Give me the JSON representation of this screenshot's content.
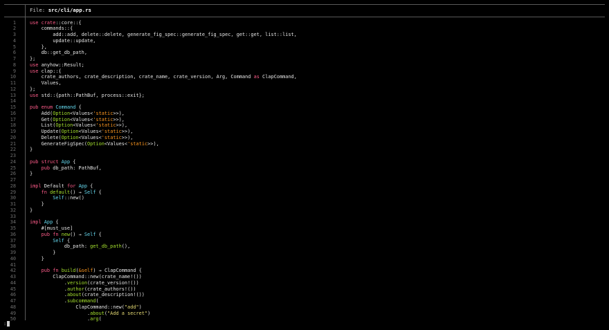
{
  "header": {
    "label": "File: ",
    "path": "src/cli/app.rs"
  },
  "prompt": ":",
  "lines": [
    {
      "n": "1",
      "t": [
        [
          "kw",
          "use"
        ],
        [
          "pt",
          " "
        ],
        [
          "kw",
          "crate"
        ],
        [
          "pt",
          "::core::{"
        ]
      ]
    },
    {
      "n": "2",
      "t": [
        [
          "pt",
          "    commands::{"
        ]
      ]
    },
    {
      "n": "3",
      "t": [
        [
          "pt",
          "        add::add, delete::delete, generate_fig_spec::generate_fig_spec, get::get, list::list,"
        ]
      ]
    },
    {
      "n": "4",
      "t": [
        [
          "pt",
          "        update::update,"
        ]
      ]
    },
    {
      "n": "5",
      "t": [
        [
          "pt",
          "    },"
        ]
      ]
    },
    {
      "n": "6",
      "t": [
        [
          "pt",
          "    db::get_db_path,"
        ]
      ]
    },
    {
      "n": "7",
      "t": [
        [
          "pt",
          "};"
        ]
      ]
    },
    {
      "n": "8",
      "t": [
        [
          "kw",
          "use"
        ],
        [
          "pt",
          " anyhow::Result;"
        ]
      ]
    },
    {
      "n": "9",
      "t": [
        [
          "kw",
          "use"
        ],
        [
          "pt",
          " clap::{"
        ]
      ]
    },
    {
      "n": "10",
      "t": [
        [
          "pt",
          "    crate_authors, crate_description, crate_name, crate_version, Arg, Command "
        ],
        [
          "kw",
          "as"
        ],
        [
          "pt",
          " ClapCommand,"
        ]
      ]
    },
    {
      "n": "11",
      "t": [
        [
          "pt",
          "    Values,"
        ]
      ]
    },
    {
      "n": "12",
      "t": [
        [
          "pt",
          "};"
        ]
      ]
    },
    {
      "n": "13",
      "t": [
        [
          "kw",
          "use"
        ],
        [
          "pt",
          " std::{path::PathBuf, process::exit};"
        ]
      ]
    },
    {
      "n": "14",
      "t": [
        [
          "pt",
          ""
        ]
      ]
    },
    {
      "n": "15",
      "t": [
        [
          "kw",
          "pub"
        ],
        [
          "pt",
          " "
        ],
        [
          "kw",
          "enum"
        ],
        [
          "pt",
          " "
        ],
        [
          "ty",
          "Command"
        ],
        [
          "pt",
          " {"
        ]
      ]
    },
    {
      "n": "16",
      "t": [
        [
          "pt",
          "    Add("
        ],
        [
          "gn",
          "Option"
        ],
        [
          "pt",
          "<Values<"
        ],
        [
          "lt",
          "'static"
        ],
        [
          "pt",
          ">>),"
        ]
      ]
    },
    {
      "n": "17",
      "t": [
        [
          "pt",
          "    Get("
        ],
        [
          "gn",
          "Option"
        ],
        [
          "pt",
          "<Values<"
        ],
        [
          "lt",
          "'static"
        ],
        [
          "pt",
          ">>),"
        ]
      ]
    },
    {
      "n": "18",
      "t": [
        [
          "pt",
          "    List("
        ],
        [
          "gn",
          "Option"
        ],
        [
          "pt",
          "<Values<"
        ],
        [
          "lt",
          "'static"
        ],
        [
          "pt",
          ">>),"
        ]
      ]
    },
    {
      "n": "19",
      "t": [
        [
          "pt",
          "    Update("
        ],
        [
          "gn",
          "Option"
        ],
        [
          "pt",
          "<Values<"
        ],
        [
          "lt",
          "'static"
        ],
        [
          "pt",
          ">>),"
        ]
      ]
    },
    {
      "n": "20",
      "t": [
        [
          "pt",
          "    Delete("
        ],
        [
          "gn",
          "Option"
        ],
        [
          "pt",
          "<Values<"
        ],
        [
          "lt",
          "'static"
        ],
        [
          "pt",
          ">>),"
        ]
      ]
    },
    {
      "n": "21",
      "t": [
        [
          "pt",
          "    GenerateFigSpec("
        ],
        [
          "gn",
          "Option"
        ],
        [
          "pt",
          "<Values<"
        ],
        [
          "lt",
          "'static"
        ],
        [
          "pt",
          ">>),"
        ]
      ]
    },
    {
      "n": "22",
      "t": [
        [
          "pt",
          "}"
        ]
      ]
    },
    {
      "n": "23",
      "t": [
        [
          "pt",
          ""
        ]
      ]
    },
    {
      "n": "24",
      "t": [
        [
          "kw",
          "pub"
        ],
        [
          "pt",
          " "
        ],
        [
          "kw",
          "struct"
        ],
        [
          "pt",
          " "
        ],
        [
          "ty",
          "App"
        ],
        [
          "pt",
          " {"
        ]
      ]
    },
    {
      "n": "25",
      "t": [
        [
          "pt",
          "    "
        ],
        [
          "kw",
          "pub"
        ],
        [
          "pt",
          " db_path: PathBuf,"
        ]
      ]
    },
    {
      "n": "26",
      "t": [
        [
          "pt",
          "}"
        ]
      ]
    },
    {
      "n": "27",
      "t": [
        [
          "pt",
          ""
        ]
      ]
    },
    {
      "n": "28",
      "t": [
        [
          "kw",
          "impl"
        ],
        [
          "pt",
          " Default "
        ],
        [
          "kw",
          "for"
        ],
        [
          "pt",
          " "
        ],
        [
          "ty",
          "App"
        ],
        [
          "pt",
          " {"
        ]
      ]
    },
    {
      "n": "29",
      "t": [
        [
          "pt",
          "    "
        ],
        [
          "kw",
          "fn"
        ],
        [
          "pt",
          " "
        ],
        [
          "fn",
          "default"
        ],
        [
          "pt",
          "() → "
        ],
        [
          "ty",
          "Self"
        ],
        [
          "pt",
          " {"
        ]
      ]
    },
    {
      "n": "30",
      "t": [
        [
          "pt",
          "        "
        ],
        [
          "ty",
          "Self"
        ],
        [
          "pt",
          "::new()"
        ]
      ]
    },
    {
      "n": "31",
      "t": [
        [
          "pt",
          "    }"
        ]
      ]
    },
    {
      "n": "32",
      "t": [
        [
          "pt",
          "}"
        ]
      ]
    },
    {
      "n": "33",
      "t": [
        [
          "pt",
          ""
        ]
      ]
    },
    {
      "n": "34",
      "t": [
        [
          "kw",
          "impl"
        ],
        [
          "pt",
          " "
        ],
        [
          "ty",
          "App"
        ],
        [
          "pt",
          " {"
        ]
      ]
    },
    {
      "n": "35",
      "t": [
        [
          "pt",
          "    #[must_use]"
        ]
      ]
    },
    {
      "n": "36",
      "t": [
        [
          "pt",
          "    "
        ],
        [
          "kw",
          "pub"
        ],
        [
          "pt",
          " "
        ],
        [
          "kw",
          "fn"
        ],
        [
          "pt",
          " "
        ],
        [
          "fn",
          "new"
        ],
        [
          "pt",
          "() → "
        ],
        [
          "ty",
          "Self"
        ],
        [
          "pt",
          " {"
        ]
      ]
    },
    {
      "n": "37",
      "t": [
        [
          "pt",
          "        "
        ],
        [
          "ty",
          "Self"
        ],
        [
          "pt",
          " {"
        ]
      ]
    },
    {
      "n": "38",
      "t": [
        [
          "pt",
          "            db_path: "
        ],
        [
          "fn",
          "get_db_path"
        ],
        [
          "pt",
          "(),"
        ]
      ]
    },
    {
      "n": "39",
      "t": [
        [
          "pt",
          "        }"
        ]
      ]
    },
    {
      "n": "40",
      "t": [
        [
          "pt",
          "    }"
        ]
      ]
    },
    {
      "n": "41",
      "t": [
        [
          "pt",
          ""
        ]
      ]
    },
    {
      "n": "42",
      "t": [
        [
          "pt",
          "    "
        ],
        [
          "kw",
          "pub"
        ],
        [
          "pt",
          " "
        ],
        [
          "kw",
          "fn"
        ],
        [
          "pt",
          " "
        ],
        [
          "fn",
          "build"
        ],
        [
          "pt",
          "("
        ],
        [
          "lt",
          "&self"
        ],
        [
          "pt",
          ") → ClapCommand {"
        ]
      ]
    },
    {
      "n": "43",
      "t": [
        [
          "pt",
          "        ClapCommand::new(crate_name!())"
        ]
      ]
    },
    {
      "n": "44",
      "t": [
        [
          "pt",
          "            ."
        ],
        [
          "fn",
          "version"
        ],
        [
          "pt",
          "(crate_version!())"
        ]
      ]
    },
    {
      "n": "45",
      "t": [
        [
          "pt",
          "            ."
        ],
        [
          "fn",
          "author"
        ],
        [
          "pt",
          "(crate_authors!())"
        ]
      ]
    },
    {
      "n": "46",
      "t": [
        [
          "pt",
          "            ."
        ],
        [
          "fn",
          "about"
        ],
        [
          "pt",
          "(crate_description!())"
        ]
      ]
    },
    {
      "n": "47",
      "t": [
        [
          "pt",
          "            ."
        ],
        [
          "fn",
          "subcommand"
        ],
        [
          "pt",
          "("
        ]
      ]
    },
    {
      "n": "48",
      "t": [
        [
          "pt",
          "                ClapCommand::new("
        ],
        [
          "st",
          "\"add\""
        ],
        [
          "pt",
          ")"
        ]
      ]
    },
    {
      "n": "49",
      "t": [
        [
          "pt",
          "                    ."
        ],
        [
          "fn",
          "about"
        ],
        [
          "pt",
          "("
        ],
        [
          "st",
          "\"Add a secret\""
        ],
        [
          "pt",
          ")"
        ]
      ]
    },
    {
      "n": "50",
      "t": [
        [
          "pt",
          "                    ."
        ],
        [
          "fn",
          "arg"
        ],
        [
          "pt",
          "("
        ]
      ]
    }
  ]
}
